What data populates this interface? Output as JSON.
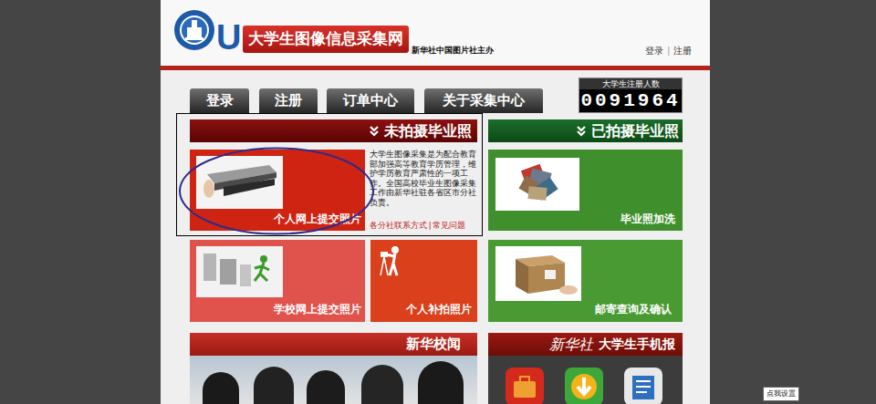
{
  "header": {
    "logo_letter": "U",
    "site_title": "大学生图像信息采集网",
    "sponsor": "新华社中国图片社主办",
    "top_links": [
      "登录",
      "注册"
    ],
    "top_separator": "|"
  },
  "nav": [
    {
      "label": "登录"
    },
    {
      "label": "注册"
    },
    {
      "label": "订单中心"
    },
    {
      "label": "关于采集中心"
    }
  ],
  "counter": {
    "label": "大学生注册人数",
    "digits": "0091964"
  },
  "sections": [
    {
      "title": "未拍摄毕业照"
    },
    {
      "title": "已拍摄毕业照"
    }
  ],
  "intro": {
    "text": "大学生图像采集是为配合教育部加强高等教育学历管理，维护学历教育严肃性的一项工作。全国高校毕业生图像采集工作由新华社驻各省区市分社负责。",
    "links": [
      "各分社联系方式",
      "常见问题"
    ],
    "separator": "|"
  },
  "tiles": [
    {
      "label": "个人网上提交照片",
      "color": "#cf2412",
      "annotated": true
    },
    {
      "label": "毕业照加洗",
      "color": "#3f8f2c",
      "annotated": false
    },
    {
      "label": "学校网上提交照片",
      "color": "#e0524c",
      "annotated": false
    },
    {
      "label": "个人补拍照片",
      "color": "#d9401b",
      "annotated": false
    },
    {
      "label": "邮寄查询及确认",
      "color": "#4a9a34",
      "annotated": false
    }
  ],
  "news": {
    "title": "新华校闻"
  },
  "mobile": {
    "brand": "新华社",
    "title": "大学生手机报"
  },
  "tooltip": "点我设置"
}
